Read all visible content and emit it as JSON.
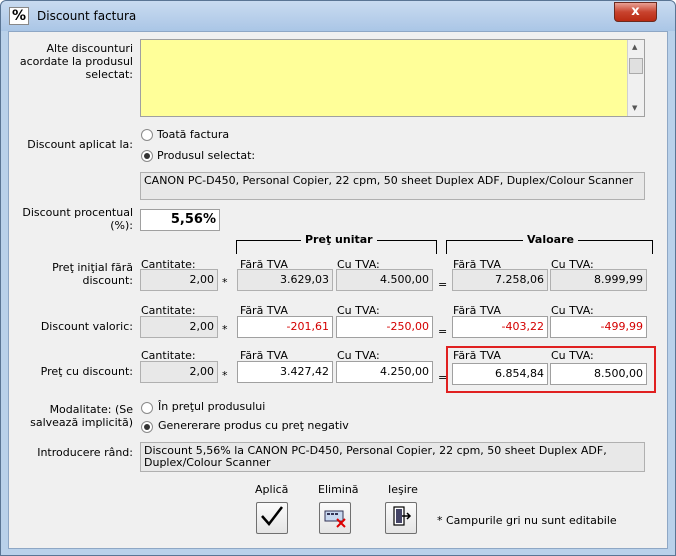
{
  "window": {
    "title": "Discount factura",
    "icon": "percent-icon",
    "close_label": "x"
  },
  "other_discounts": {
    "label": "Alte discounturi acordate la produsul selectat:",
    "value": ""
  },
  "applied_to": {
    "label": "Discount aplicat la:",
    "options": [
      {
        "label": "Toată factura",
        "selected": false
      },
      {
        "label": "Produsul selectat:",
        "selected": true
      }
    ],
    "product": "CANON PC-D450, Personal Copier, 22 cpm, 50 sheet Duplex ADF, Duplex/Colour Scanner"
  },
  "percent": {
    "label": "Discount procentual (%):",
    "value": "5,56%"
  },
  "headers": {
    "unit_price": "Preţ unitar",
    "value": "Valoare"
  },
  "col_labels": {
    "qty": "Cantitate:",
    "no_vat": "Fără TVA",
    "with_vat": "Cu TVA:"
  },
  "rows": [
    {
      "label": "Preţ iniţial fără discount:",
      "qty": "2,00",
      "unit_no_vat": "3.629,03",
      "unit_vat": "4.500,00",
      "val_no_vat": "7.258,06",
      "val_vat": "8.999,99",
      "times": "*",
      "equals": "="
    },
    {
      "label": "Discount valoric:",
      "qty": "2,00",
      "unit_no_vat": "-201,61",
      "unit_vat": "-250,00",
      "val_no_vat": "-403,22",
      "val_vat": "-499,99",
      "times": "*",
      "equals": "="
    },
    {
      "label": "Preţ cu discount:",
      "qty": "2,00",
      "unit_no_vat": "3.427,42",
      "unit_vat": "4.250,00",
      "val_no_vat": "6.854,84",
      "val_vat": "8.500,00",
      "times": "*",
      "equals": "="
    }
  ],
  "mode": {
    "label": "Modalitate: (Se salvează implicită)",
    "options": [
      {
        "label": "În preţul produsului",
        "selected": false
      },
      {
        "label": "Genererare produs cu preţ negativ",
        "selected": true
      }
    ]
  },
  "row_intro": {
    "label": "Introducere rând:",
    "value": "Discount 5,56% la CANON PC-D450, Personal Copier, 22 cpm, 50 sheet Duplex ADF, Duplex/Colour Scanner"
  },
  "buttons": {
    "apply": "Aplică",
    "delete": "Elimină",
    "exit": "Ieşire"
  },
  "note": "* Campurile gri nu sunt editabile",
  "colors": {
    "highlight": "#e02020",
    "yellow": "#ffff99",
    "negative": "#d40000"
  }
}
